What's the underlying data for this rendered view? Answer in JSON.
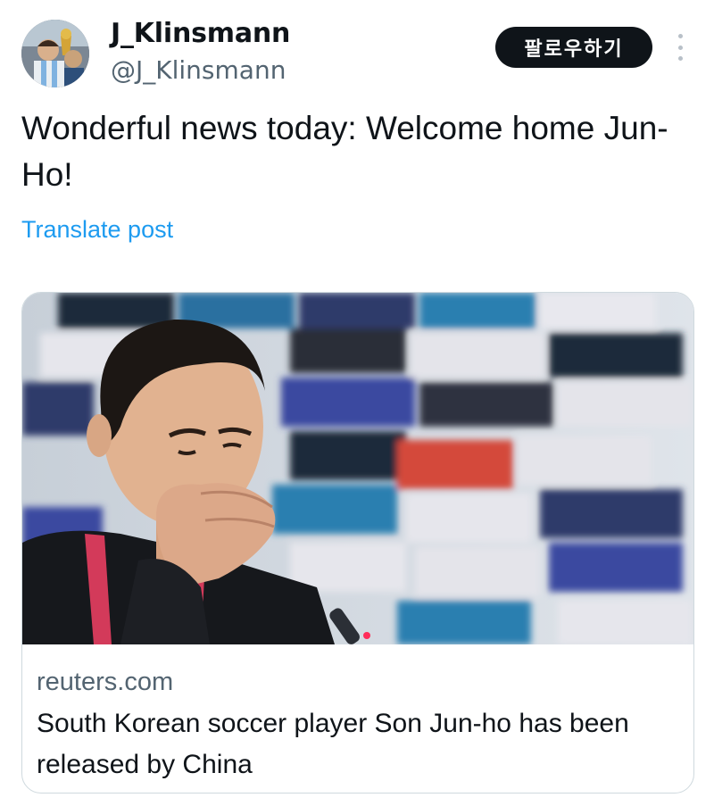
{
  "author": {
    "display_name": "J_Klinsmann",
    "handle": "@J_Klinsmann"
  },
  "actions": {
    "follow_label": "팔로우하기",
    "more_icon": "more-options-icon"
  },
  "post": {
    "text": "Wonderful news today: Welcome home Jun-Ho!",
    "translate_label": "Translate post"
  },
  "link_card": {
    "domain": "reuters.com",
    "title": "South Korean soccer player Son Jun-ho has been released by China"
  },
  "colors": {
    "text_primary": "#0f1419",
    "text_secondary": "#536471",
    "link_blue": "#1d9bf0",
    "button_bg": "#0f1419",
    "border": "#cfd9de"
  }
}
